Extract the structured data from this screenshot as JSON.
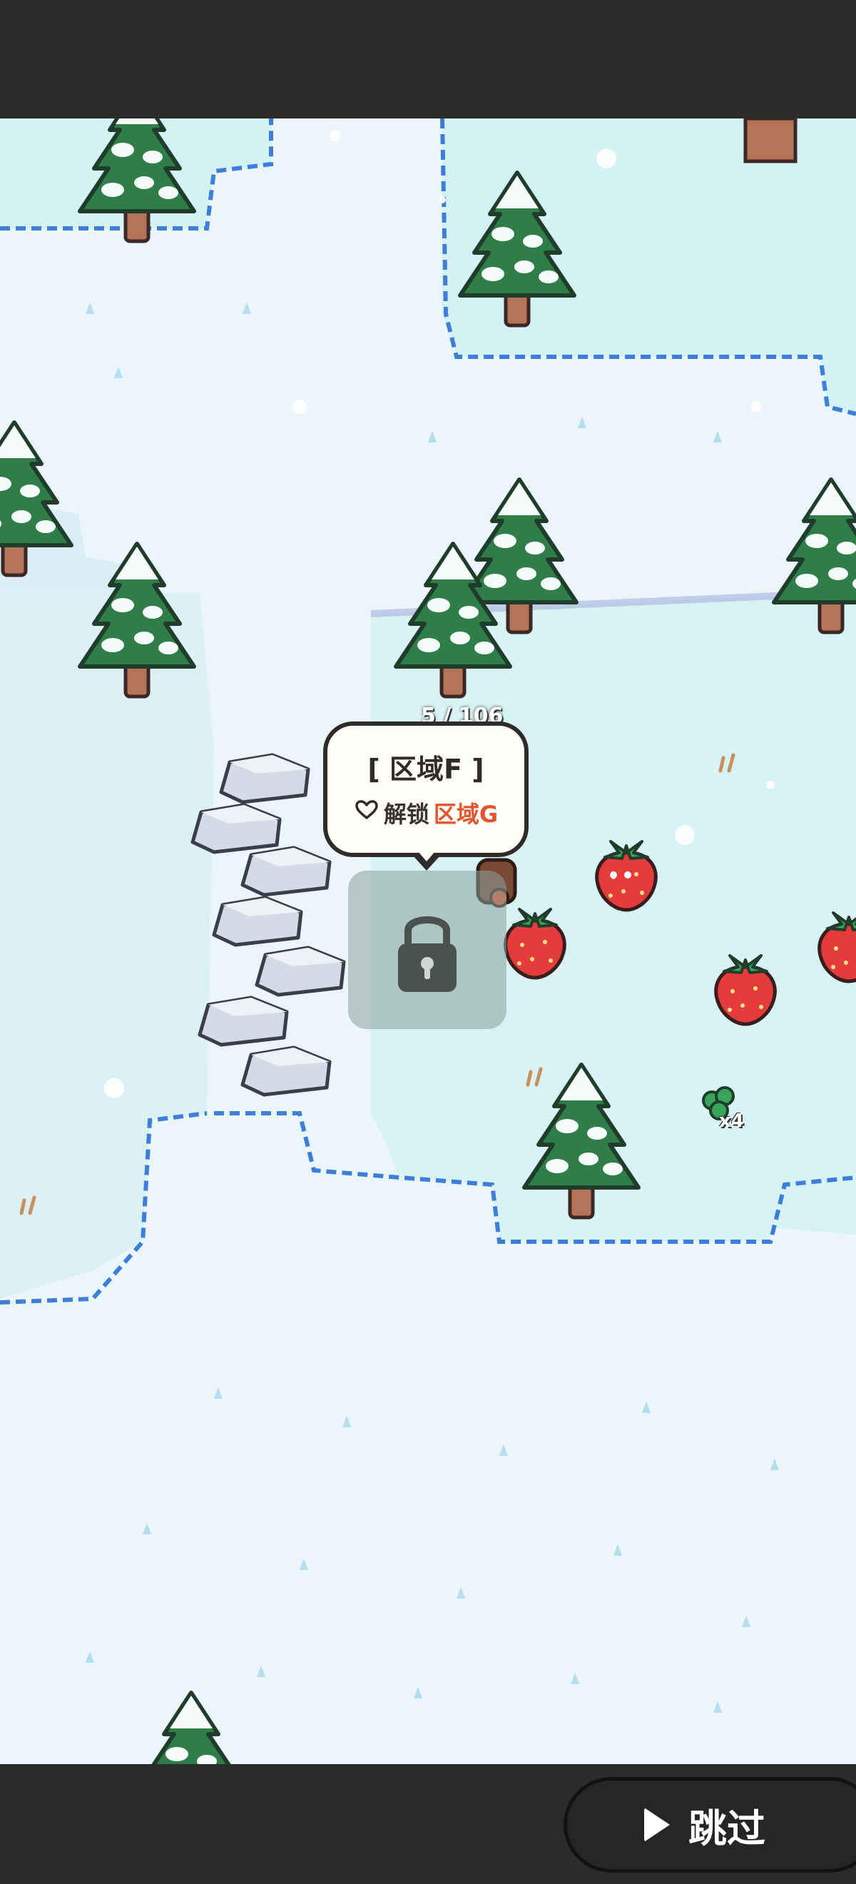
{
  "zone_popup": {
    "title": "[ 区域F ]",
    "unlock_prefix": "解锁",
    "unlock_target": "区域G",
    "heart_icon": "heart-outline-icon"
  },
  "player_hud": {
    "count_text": "5 / 106"
  },
  "item_drop": {
    "quantity_label": "x4"
  },
  "skip_button": {
    "label": "跳过",
    "icon": "play-icon"
  },
  "colors": {
    "snow": "#eef8fb",
    "ice_water": "#d7f2f4",
    "ice_edge": "#3d7fd8",
    "tree_green": "#2e7a46",
    "strawberry": "#e83a3a",
    "highlight": "#e2562f",
    "bar": "#2d2a2a"
  }
}
